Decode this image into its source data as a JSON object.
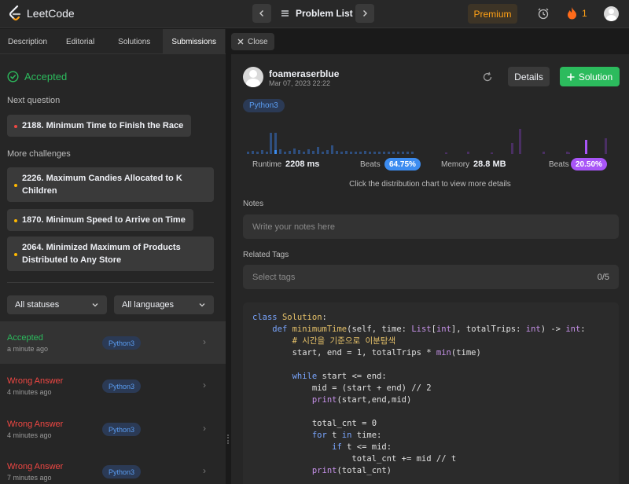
{
  "topnav": {
    "logo_text": "LeetCode",
    "problem_list": "Problem List",
    "premium": "Premium",
    "streak": "1"
  },
  "left": {
    "tabs": [
      "Description",
      "Editorial",
      "Solutions",
      "Submissions"
    ],
    "active_tab": "Submissions",
    "accepted": "Accepted",
    "next_question_label": "Next question",
    "next_question": "2188. Minimum Time to Finish the Race",
    "more_challenges_label": "More challenges",
    "challenges": [
      "2226. Maximum Candies Allocated to K Children",
      "1870. Minimum Speed to Arrive on Time",
      "2064. Minimized Maximum of Products Distributed to Any Store"
    ],
    "filters": {
      "status": "All statuses",
      "language": "All languages"
    },
    "submissions": [
      {
        "status": "Accepted",
        "time": "a minute ago",
        "lang": "Python3"
      },
      {
        "status": "Wrong Answer",
        "time": "4 minutes ago",
        "lang": "Python3"
      },
      {
        "status": "Wrong Answer",
        "time": "4 minutes ago",
        "lang": "Python3"
      },
      {
        "status": "Wrong Answer",
        "time": "7 minutes ago",
        "lang": "Python3"
      }
    ]
  },
  "right": {
    "close": "Close",
    "username": "foameraserblue",
    "date": "Mar 07, 2023 22:22",
    "details": "Details",
    "solution": "Solution",
    "language": "Python3",
    "runtime_label": "Runtime",
    "runtime_value": "2208 ms",
    "runtime_beats_label": "Beats",
    "runtime_beats": "64.75%",
    "memory_label": "Memory",
    "memory_value": "28.8 MB",
    "memory_beats_label": "Beats",
    "memory_beats": "20.50%",
    "hint": "Click the distribution chart to view more details",
    "notes_label": "Notes",
    "notes_placeholder": "Write your notes here",
    "tags_label": "Related Tags",
    "tags_placeholder": "Select tags",
    "tags_count": "0/5"
  },
  "code_lines": [
    "class Solution:",
    "    def minimumTime(self, time: List[int], totalTrips: int) -> int:",
    "        # 시간을 기준으로 이분탐색",
    "        start, end = 1, totalTrips * min(time)",
    "",
    "        while start <= end:",
    "            mid = (start + end) // 2",
    "            print(start,end,mid)",
    "",
    "            total_cnt = 0",
    "            for t in time:",
    "                if t <= mid:",
    "                    total_cnt += mid // t",
    "            print(total_cnt)"
  ],
  "colors": {
    "accepted": "#2cbb5d",
    "wrong": "#ef4743",
    "brand": "#ffa116",
    "runtime_bar": "#2f4f7f",
    "runtime_highlight": "#3c8cf0",
    "memory_bar": "#4a2f63",
    "memory_highlight": "#a855f7"
  }
}
